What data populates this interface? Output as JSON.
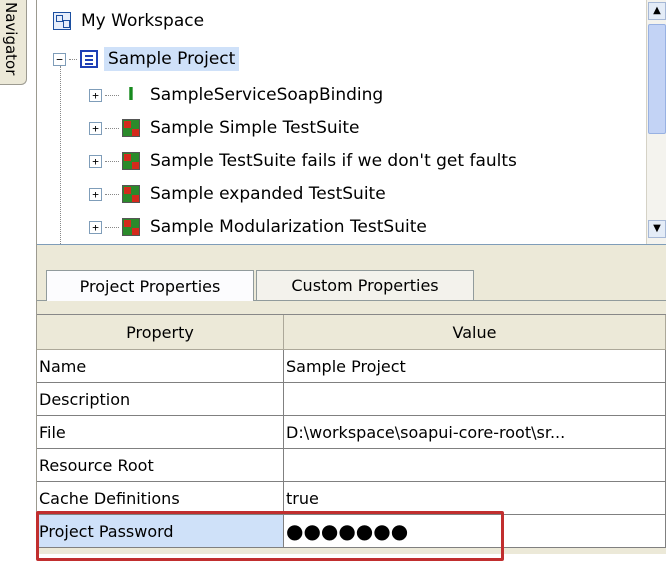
{
  "side_tab": {
    "label": "Navigator"
  },
  "tree": {
    "workspace": "My Workspace",
    "project": "Sample Project",
    "children": [
      {
        "label": "SampleServiceSoapBinding",
        "icon": "interface-icon"
      },
      {
        "label": "Sample Simple TestSuite",
        "icon": "testsuite-icon"
      },
      {
        "label": "Sample TestSuite fails if we don't get faults",
        "icon": "testsuite-icon"
      },
      {
        "label": "Sample expanded TestSuite",
        "icon": "testsuite-icon"
      },
      {
        "label": "Sample Modularization TestSuite",
        "icon": "testsuite-icon"
      }
    ]
  },
  "tabs": [
    "Project Properties",
    "Custom Properties"
  ],
  "table": {
    "headers": [
      "Property",
      "Value"
    ],
    "rows": [
      {
        "property": "Name",
        "value": "Sample Project"
      },
      {
        "property": "Description",
        "value": ""
      },
      {
        "property": "File",
        "value": "D:\\workspace\\soapui-core-root\\sr..."
      },
      {
        "property": "Resource Root",
        "value": ""
      },
      {
        "property": "Cache Definitions",
        "value": "true"
      },
      {
        "property": "Project Password",
        "value": "●●●●●●●"
      }
    ]
  },
  "colors": {
    "selection": "#cfe1f9",
    "highlight": "#c12e2e",
    "panel": "#ece9d8"
  }
}
